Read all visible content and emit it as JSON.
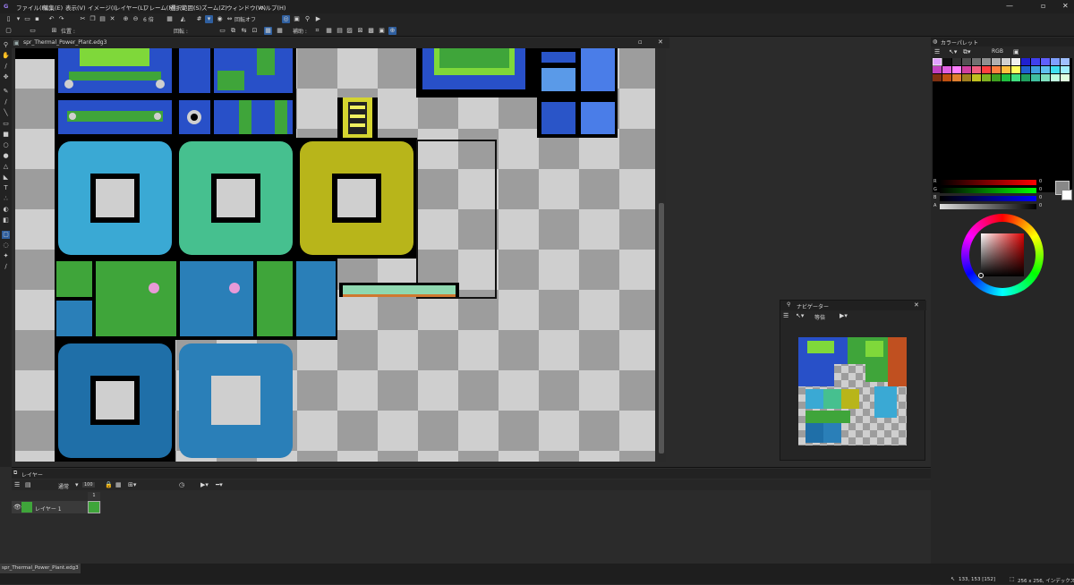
{
  "menu": [
    "ファイル(F)",
    "編集(E)",
    "表示(V)",
    "イメージ(I)",
    "レイヤー(L)",
    "フレーム(M)",
    "選択範囲(S)",
    "ズーム(Z)",
    "ウィンドウ(W)",
    "ヘルプ(H)"
  ],
  "toolbar": {
    "zoom_value": "6 倍",
    "rotate_label": "回転オフ",
    "position_label": "位置 :",
    "rotation_label": "回転 :",
    "assist_label": "補助 :"
  },
  "document": {
    "tab_title": "spr_Thermal_Power_Plant.edg3"
  },
  "color_palette": {
    "title": "カラーパレット",
    "mode": "RGB",
    "channels": [
      "R",
      "G",
      "B",
      "A"
    ],
    "channel_values": {
      "R": "0",
      "G": "0",
      "B": "0",
      "A": "0"
    }
  },
  "navigator": {
    "title": "ナビゲーター",
    "zoom": "等倍"
  },
  "layers": {
    "title": "レイヤー",
    "blend_mode": "通常",
    "opacity": "100",
    "frame_number": "1",
    "items": [
      {
        "name": "レイヤー 1"
      }
    ]
  },
  "status": {
    "bottom_tab": "spr_Thermal_Power_Plant.edg3",
    "cursor": "133, 153 [152]",
    "image_info": "256 x 256, インデックス"
  },
  "colors": {
    "accent": "#2f6fd0",
    "tile_green": "#3fa53a",
    "tile_blue": "#2a55c8",
    "tile_cyan": "#3aa9d4",
    "tile_yellow": "#b8b51a"
  }
}
